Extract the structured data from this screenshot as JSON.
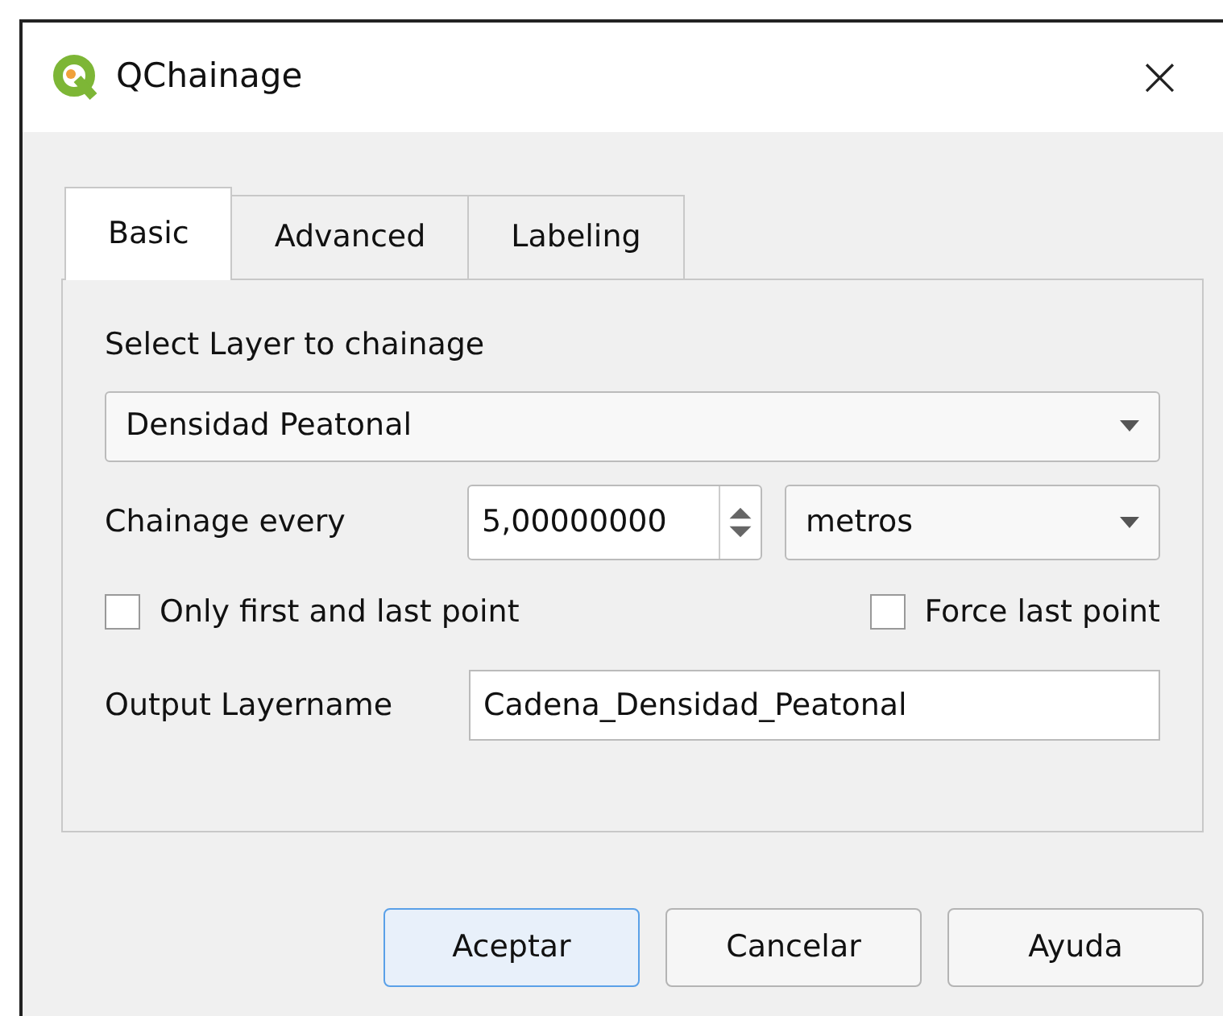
{
  "window": {
    "title": "QChainage",
    "close": "×"
  },
  "tabs": [
    {
      "label": "Basic",
      "selected": true
    },
    {
      "label": "Advanced",
      "selected": false
    },
    {
      "label": "Labeling",
      "selected": false
    }
  ],
  "layer": {
    "label": "Select Layer to chainage",
    "value": "Densidad Peatonal"
  },
  "chainage": {
    "label": "Chainage every",
    "value": "5,00000000",
    "unit": "metros"
  },
  "options": [
    {
      "label": "Only first and last point",
      "checked": false
    },
    {
      "label": "Force last point",
      "checked": false
    }
  ],
  "output": {
    "label": "Output Layername",
    "value": "Cadena_Densidad_Peatonal"
  },
  "buttons": [
    {
      "label": "Aceptar",
      "default": true
    },
    {
      "label": "Cancelar",
      "default": false
    },
    {
      "label": "Ayuda",
      "default": false
    }
  ]
}
